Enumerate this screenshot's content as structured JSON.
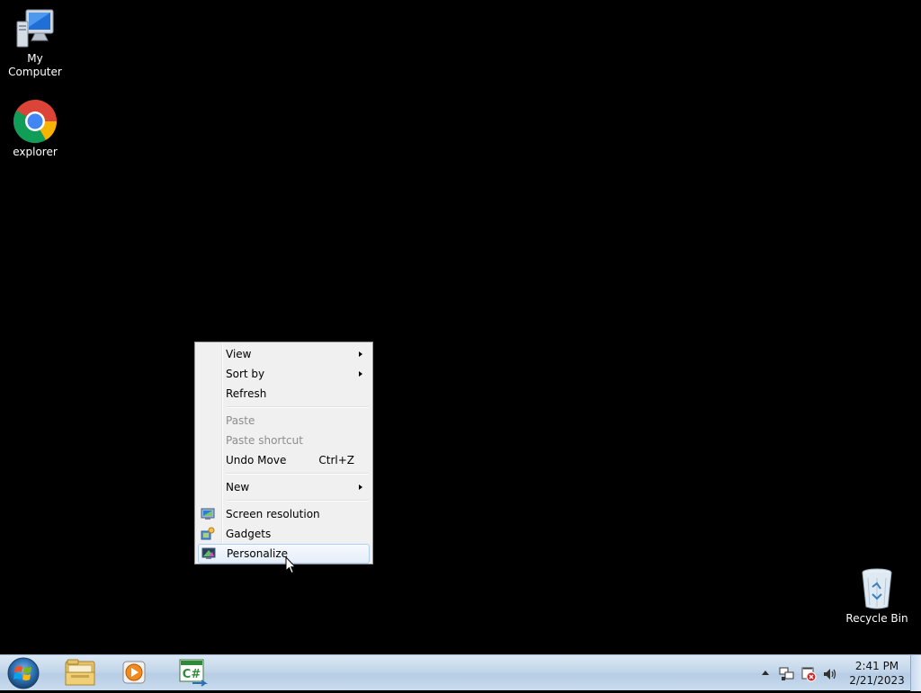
{
  "desktop": {
    "icons": [
      {
        "label": "My Computer",
        "icon": "computer-icon"
      },
      {
        "label": "explorer",
        "icon": "chrome-icon"
      },
      {
        "label": "Recycle Bin",
        "icon": "recycle-bin-icon"
      }
    ]
  },
  "context_menu": {
    "items": [
      {
        "label": "View",
        "submenu": true
      },
      {
        "label": "Sort by",
        "submenu": true
      },
      {
        "label": "Refresh"
      },
      {
        "label": "Paste",
        "disabled": true
      },
      {
        "label": "Paste shortcut",
        "disabled": true
      },
      {
        "label": "Undo Move",
        "shortcut": "Ctrl+Z"
      },
      {
        "label": "New",
        "submenu": true
      },
      {
        "label": "Screen resolution",
        "icon": "screen-resolution-icon"
      },
      {
        "label": "Gadgets",
        "icon": "gadgets-icon"
      },
      {
        "label": "Personalize",
        "icon": "personalize-icon",
        "highlighted": true
      }
    ]
  },
  "taskbar": {
    "pinned": [
      {
        "name": "Windows Explorer",
        "icon": "folder-icon"
      },
      {
        "name": "Windows Media Player",
        "icon": "media-player-icon"
      },
      {
        "name": "C# application",
        "icon": "csharp-icon"
      }
    ],
    "tray": {
      "icons": [
        "show-hidden-icons-arrow",
        "network-icon",
        "action-center-icon",
        "volume-icon"
      ]
    },
    "clock": {
      "time": "2:41 PM",
      "date": "2/21/2023"
    }
  },
  "colors": {
    "desktop_background": "#000000",
    "menu_background": "#f0f0f0",
    "menu_highlight_border": "#aecff7",
    "taskbar": "#c3d6ea"
  }
}
